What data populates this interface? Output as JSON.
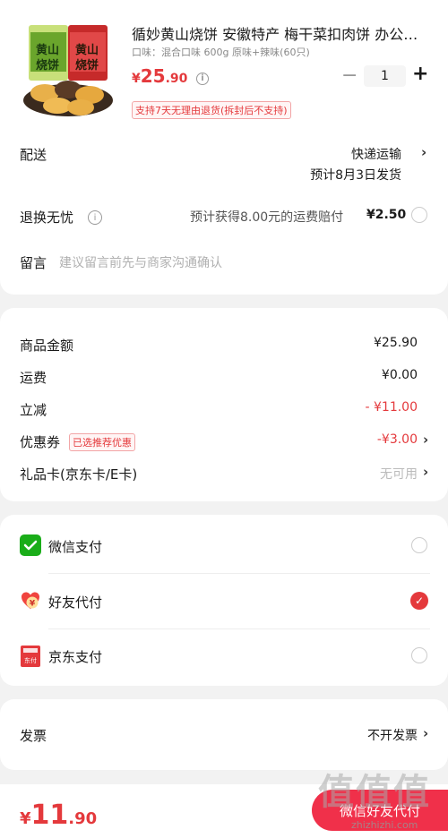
{
  "product": {
    "title": "循妙黄山烧饼  安徽特产 梅干菜扣肉饼 办公…",
    "spec": "口味：混合口味 600g 原味+辣味(60只)",
    "price_currency": "¥",
    "price_int": "25",
    "price_dec": ".90",
    "info_icon": "i",
    "qty": "1",
    "minus": "−",
    "plus": "+",
    "return_tag": "支持7天无理由退货(拆封后不支持)",
    "package_text": "黄山烧饼"
  },
  "delivery": {
    "label": "配送",
    "method": "快递运输",
    "estimate": "预计8月3日发货"
  },
  "return_insurance": {
    "label": "退换无忧",
    "info_icon": "i",
    "desc": "预计获得8.00元的运费赔付",
    "price": "¥2.50"
  },
  "message": {
    "label": "留言",
    "placeholder": "建议留言前先与商家沟通确认"
  },
  "summary": {
    "goods_label": "商品金额",
    "goods_value": "¥25.90",
    "shipping_label": "运费",
    "shipping_value": "¥0.00",
    "discount_label": "立减",
    "discount_value": "- ¥11.00",
    "coupon_label": "优惠券",
    "coupon_tag": "已选推荐优惠",
    "coupon_value": "-¥3.00",
    "giftcard_label": "礼品卡(京东卡/E卡)",
    "giftcard_value": "无可用"
  },
  "payment": {
    "wechat_label": "微信支付",
    "friend_label": "好友代付",
    "friend_icon_text": "¥",
    "jd_label": "京东支付",
    "jd_icon_text": "东付",
    "selected": "好友代付"
  },
  "invoice": {
    "label": "发票",
    "value": "不开发票"
  },
  "chevron": "›",
  "check": "✓",
  "bottom": {
    "total_currency": "¥",
    "total_int": "11",
    "total_dec": ".90",
    "pay_button": "微信好友代付",
    "watermark": "值值值",
    "watermark_url": "zhizhizhi.com"
  },
  "colors": {
    "accent": "#e4393c",
    "wechat_green": "#1aad19",
    "pay_button": "#f0304a"
  }
}
